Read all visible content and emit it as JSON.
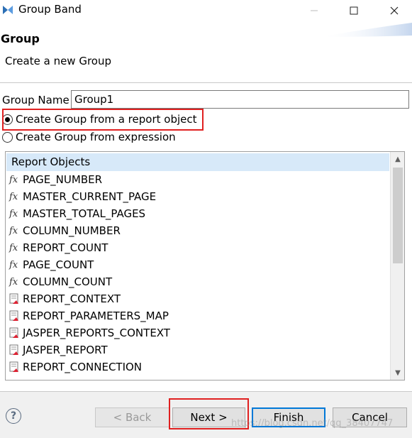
{
  "window": {
    "title": "Group Band",
    "icon": "eclipse-jaspersoft-icon"
  },
  "banner": {
    "title": "Group",
    "description": "Create a new Group"
  },
  "form": {
    "group_name_label": "Group Name",
    "group_name_value": "Group1",
    "radio_report_object": "Create Group from a report object",
    "radio_expression": "Create Group from expression",
    "selected_option": "report_object"
  },
  "report_objects": {
    "header": "Report Objects",
    "items": [
      {
        "label": "PAGE_NUMBER",
        "icon": "fx-icon"
      },
      {
        "label": "MASTER_CURRENT_PAGE",
        "icon": "fx-icon"
      },
      {
        "label": "MASTER_TOTAL_PAGES",
        "icon": "fx-icon"
      },
      {
        "label": "COLUMN_NUMBER",
        "icon": "fx-icon"
      },
      {
        "label": "REPORT_COUNT",
        "icon": "fx-icon"
      },
      {
        "label": "PAGE_COUNT",
        "icon": "fx-icon"
      },
      {
        "label": "COLUMN_COUNT",
        "icon": "fx-icon"
      },
      {
        "label": "REPORT_CONTEXT",
        "icon": "parameter-icon"
      },
      {
        "label": "REPORT_PARAMETERS_MAP",
        "icon": "parameter-icon"
      },
      {
        "label": "JASPER_REPORTS_CONTEXT",
        "icon": "parameter-icon"
      },
      {
        "label": "JASPER_REPORT",
        "icon": "parameter-icon"
      },
      {
        "label": "REPORT_CONNECTION",
        "icon": "parameter-icon"
      }
    ]
  },
  "buttons": {
    "back": "< Back",
    "next": "Next >",
    "finish": "Finish",
    "cancel": "Cancel"
  },
  "watermark": "https://blog.csdn.net/qq_38407747",
  "colors": {
    "highlight_box": "#e02020",
    "list_header_bg": "#d7e9f9",
    "default_button_border": "#0078d7"
  }
}
